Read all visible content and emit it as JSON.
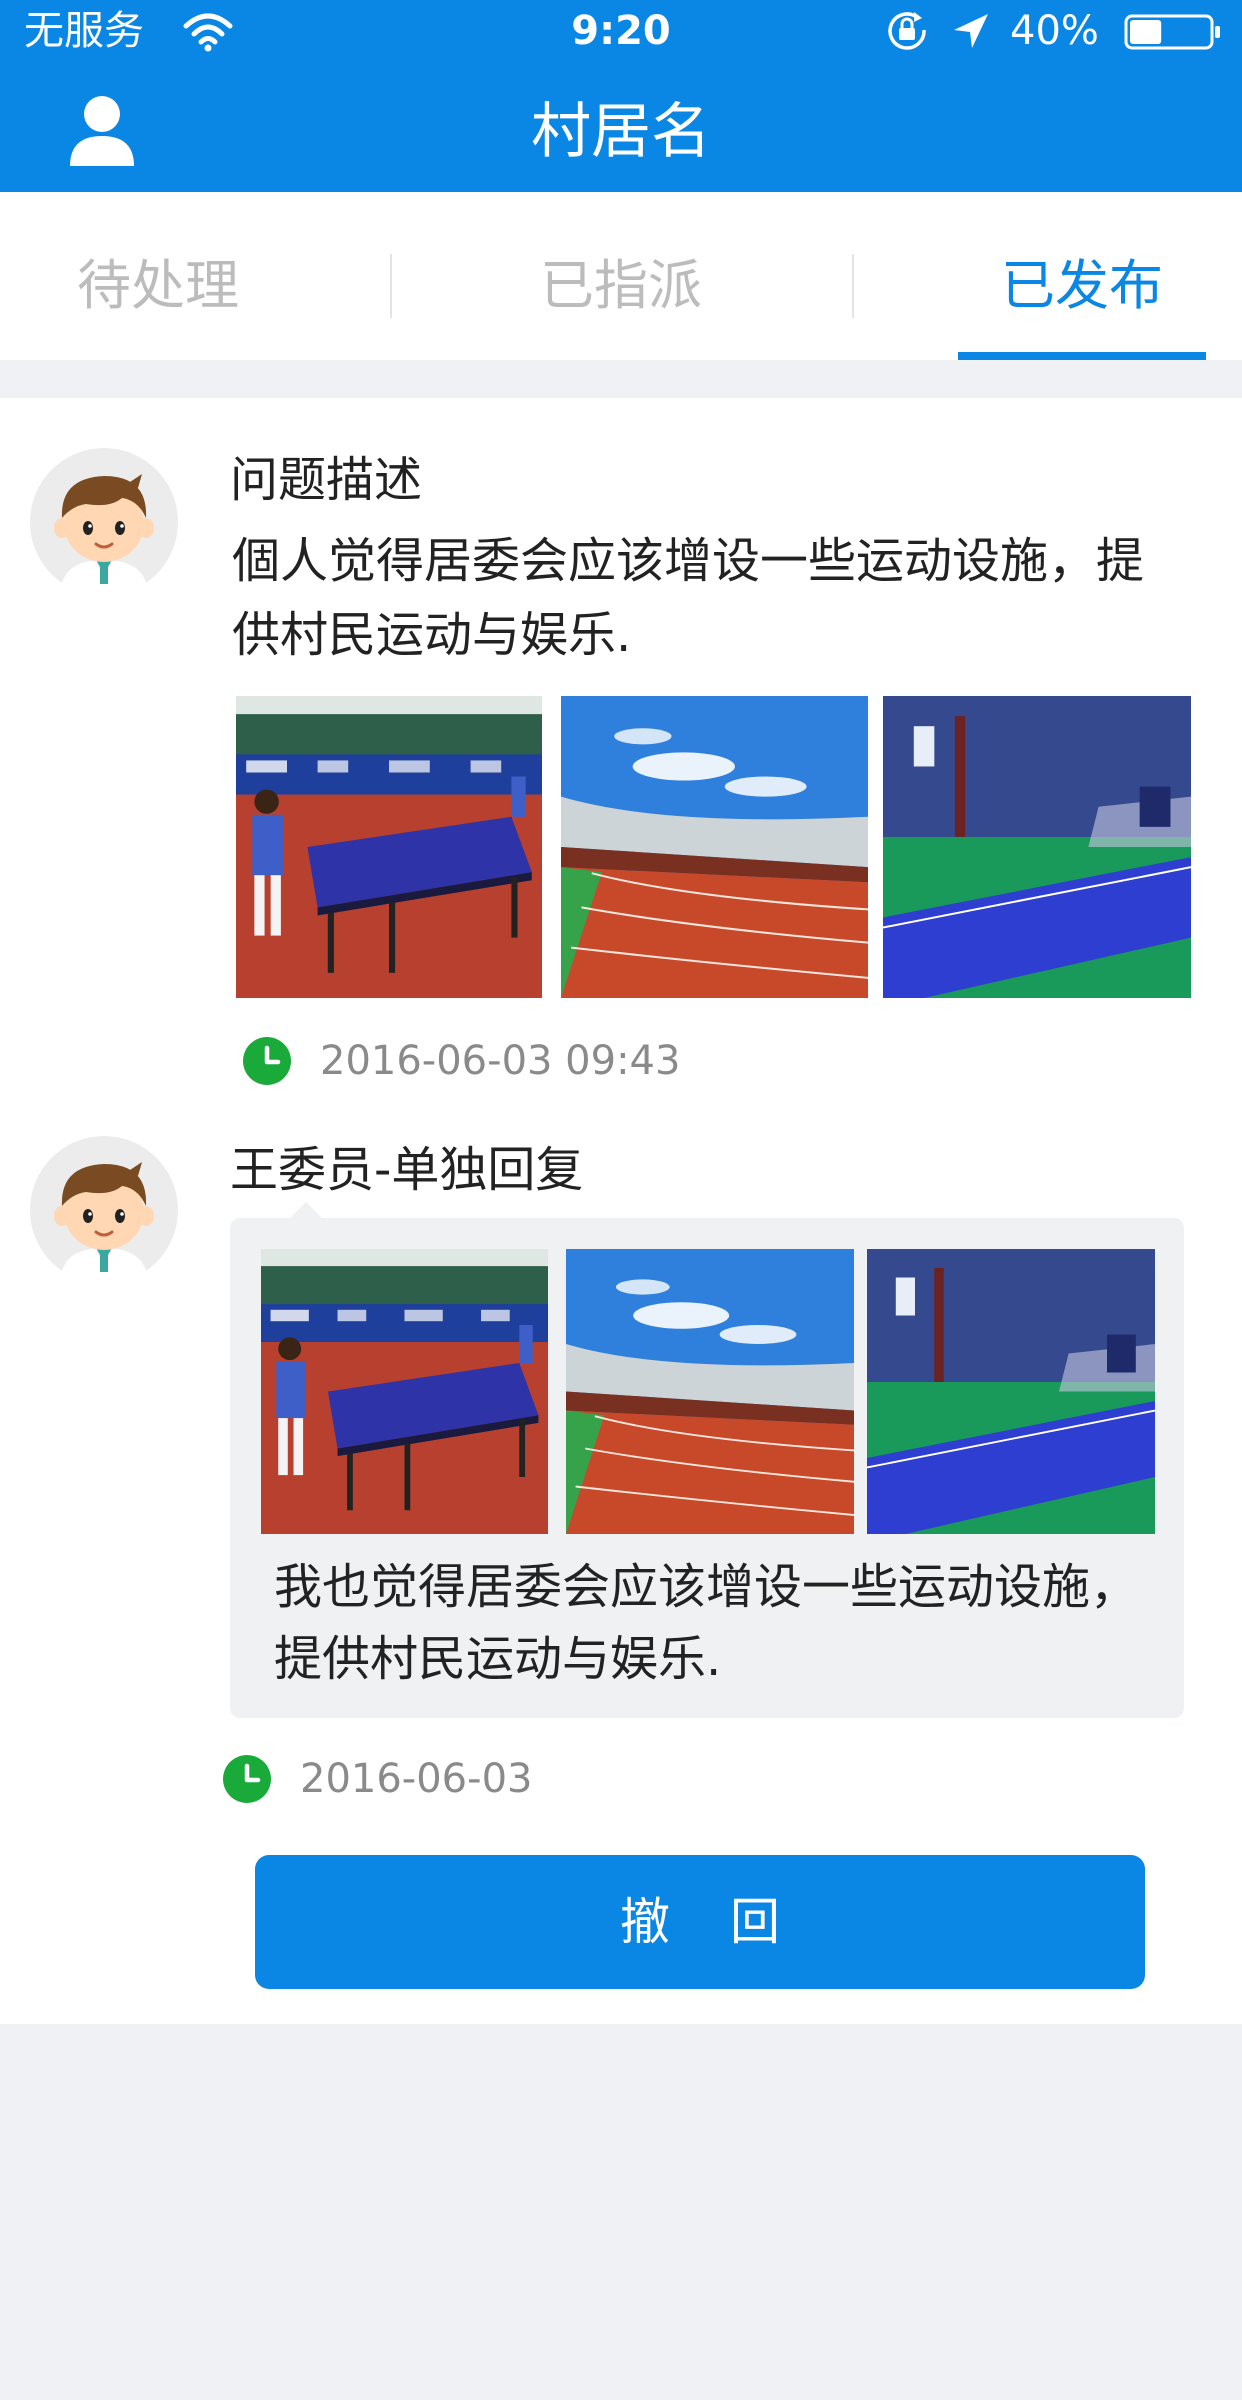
{
  "status_bar": {
    "carrier": "无服务",
    "time": "9:20",
    "battery_percent": "40%",
    "battery_level": 0.4
  },
  "header": {
    "title": "村居名"
  },
  "tabs": [
    {
      "label": "待处理",
      "active": false
    },
    {
      "label": "已指派",
      "active": false
    },
    {
      "label": "已发布",
      "active": true
    }
  ],
  "post": {
    "title": "问题描述",
    "body_line1": "個人觉得居委会应该增设一些运动设施，提",
    "body_line2": "供村民运动与娱乐.",
    "photos": [
      "table-tennis-hall-photo",
      "stadium-track-photo",
      "blue-table-tennis-photo"
    ],
    "timestamp": "2016-06-03  09:43"
  },
  "reply": {
    "title": "王委员-单独回复",
    "photos": [
      "table-tennis-hall-photo",
      "stadium-track-photo",
      "blue-table-tennis-photo"
    ],
    "body_line1": "我也觉得居委会应该增设一些运动设施，",
    "body_line2": "提供村民运动与娱乐.",
    "timestamp": "2016-06-03"
  },
  "actions": {
    "withdraw_label": "撤回"
  },
  "colors": {
    "primary": "#0a86e4",
    "clock_green": "#1aaa3a",
    "inactive_tab": "#bcbcbc",
    "timestamp_gray": "#8a8a8a",
    "page_bg": "#eff1f4"
  },
  "icons": {
    "wifi": "wifi-icon",
    "orientation_lock": "orientation-lock-icon",
    "location": "location-arrow-icon",
    "battery": "battery-icon",
    "user": "user-icon",
    "clock": "clock-icon"
  }
}
